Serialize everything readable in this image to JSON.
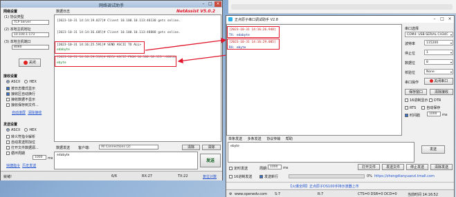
{
  "net": {
    "title": "网络调试助手",
    "brand": "NetAssist V5.0.2",
    "net_settings_title": "网络设置",
    "protocol_label": "(1) 协议类型",
    "protocol_value": "TCP Server",
    "local_ip_label": "(2) 本地主机地址",
    "local_ip_value": "10.100.1.173",
    "local_port_label": "(3) 本地主机端口",
    "local_port_value": "8080",
    "close_button": "关闭",
    "recv_settings_title": "接收设置",
    "recv_ascii": "ASCII",
    "recv_hex": "HEX",
    "recv_opt1": "按日志模式显示",
    "recv_opt2": "接收区自动换行",
    "recv_opt3": "接收数据不显示",
    "recv_opt4": "接收保存到文件...",
    "recv_link1": "自动滚屏",
    "recv_link2": "清除接收",
    "send_settings_title": "发送设置",
    "send_ascii": "ASCII",
    "send_hex": "HEX",
    "send_opt1": "转义符指令解析",
    "send_opt2": "自动发送附加位",
    "send_opt3": "打开文件数据源...",
    "send_opt4": "循环周期",
    "cycle_value": "1000",
    "cycle_unit": "ms",
    "send_link1": "快捷指令",
    "send_link2": "历史发送",
    "log_tab": "数据日志",
    "log_lines": [
      "[2023-10-31 14:14:19.027]# Client 10.100.10.113:46130 gets online.",
      "[2023-10-31 14:14:36.685]# Client 10.100.10.113:48888 gets online.",
      "[2023-10-31 14:16:25.591]# SEND ASCII TO ALL>",
      "edabyte",
      "[2023-10-31 14:16:29.519]# RECV ASCII FROM 10.100.10.113 :46810>",
      "ebyte"
    ],
    "data_send_label": "数据发送",
    "client_label": "客户端:",
    "client_value": "All Connections (2)",
    "clear_btn": "清除",
    "clear_btn2": "清除",
    "send_input": "edabyte",
    "send_btn": "发送",
    "status_ready": "就绪!",
    "status_count": "6/6",
    "status_rx": "RX:27",
    "status_tx": "TX:22",
    "status_reset": "复位计数"
  },
  "uart": {
    "title": "正点原子串口调试助手 V2.8",
    "recv_lines": [
      "[2023-10-31 14:16:26.948]",
      "TX: edabyte",
      "[2023-10-31 14:16:29.085]",
      "RX: ebyte"
    ],
    "port_label": "串口选择",
    "port_value": "COM4: USB-SERIAL CH34C",
    "baud_label": "波特率",
    "baud_value": "115200",
    "stop_label": "停止位",
    "stop_value": "1",
    "data_label": "数据位",
    "data_value": "8",
    "parity_label": "校验位",
    "parity_value": "None",
    "op_label": "串口操作",
    "op_button": "关闭串口",
    "save_btn": "保存窗口",
    "clear_btn": "清除接收",
    "hex_display": "16进制显示",
    "dtr": "DTR",
    "rts": "RTS",
    "autosave": "自动保存",
    "timestamp": "时间戳",
    "timestamp_val": "1000",
    "timestamp_unit": "ms",
    "tabs": [
      "单条发送",
      "多条发送",
      "协议传输",
      "帮助"
    ],
    "send_text": "ebyte",
    "send_btn": "发送",
    "timed_send": "定时发送",
    "period_label": "周期:",
    "period_value": "1000",
    "period_unit": "ms",
    "open_file": "打开文件",
    "send_file": "发送文件",
    "stop_send": "停止发送",
    "hex_send": "16进制发送",
    "newline": "发送新行",
    "progress": "0%",
    "url": "【火爆全网】正点原子DS100手持示波器上市",
    "status_site": "www.openedv.com",
    "status_s": "S:7",
    "status_r": "R:7",
    "status_cts": "CTS=0 DSR=0 DCD=0",
    "status_time": "当前时间 14:16:52",
    "clear_send": "清除发送",
    "link": "https://zhengdianyuanzi.tmall.com"
  }
}
